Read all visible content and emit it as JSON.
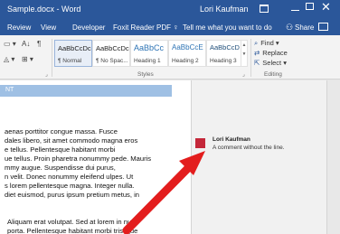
{
  "window": {
    "title": "Sample.docx - Word",
    "user": "Lori Kaufman",
    "close_glyph": "✕"
  },
  "tabs": [
    "Review",
    "View",
    "Developer",
    "Foxit Reader PDF"
  ],
  "tell_me": "Tell me what you want to do",
  "share": "Share",
  "ribbon": {
    "styles_group_label": "Styles",
    "editing_group_label": "Editing",
    "styles": [
      {
        "preview": "AaBbCcDc",
        "name": "¶ Normal"
      },
      {
        "preview": "AaBbCcDc",
        "name": "¶ No Spac..."
      },
      {
        "preview": "AaBbCc",
        "name": "Heading 1"
      },
      {
        "preview": "AaBbCcE",
        "name": "Heading 2"
      },
      {
        "preview": "AaBbCcD",
        "name": "Heading 3"
      }
    ],
    "editing": {
      "find": "Find",
      "replace": "Replace",
      "select": "Select"
    }
  },
  "document": {
    "heading": "NT",
    "paragraph1": [
      "aenas porttitor congue massa. Fusce",
      "dales libero, sit amet commodo magna eros",
      "e tellus. Pellentesque habitant morbi",
      "ue tellus. Proin pharetra nonummy pede. Mauris",
      "mmy augue. Suspendisse dui purus,",
      "n velit. Donec nonummy eleifend ulpes. Ut",
      "s lorem pellentesque magna. Integer nulla.",
      "diet euismod, purus ipsum pretium metus, in"
    ],
    "paragraph2": [
      "Aliquam erat volutpat. Sed at lorem in nunc",
      "porta. Pellentesque habitant morbi tristique"
    ]
  },
  "comment": {
    "author": "Lori Kaufman",
    "text": "A comment without the line."
  },
  "colors": {
    "accent": "#2b579a",
    "arrow": "#e31d1d",
    "avatar": "#c4273a"
  }
}
